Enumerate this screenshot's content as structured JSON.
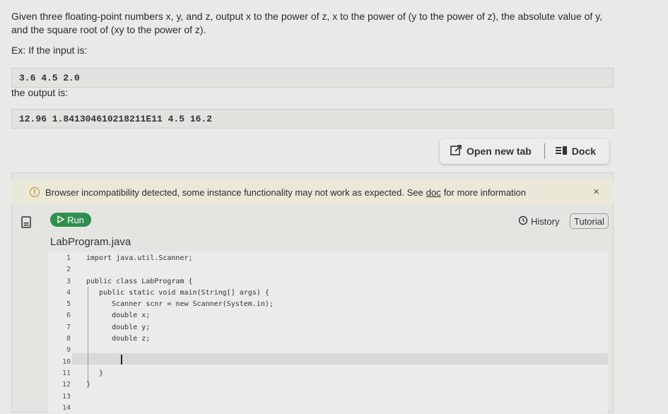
{
  "problem": {
    "statement": "Given three floating-point numbers x, y, and z, output x to the power of z, x to the power of (y to the power of z), the absolute value of y, and the square root of (xy to the power of z).",
    "example_intro": "Ex: If the input is:",
    "input_value": "3.6 4.5 2.0",
    "output_intro": "the output is:",
    "output_value": "12.96 1.841304610218211E11 4.5 16.2"
  },
  "toolbar": {
    "open_new_tab": "Open new tab",
    "dock": "Dock"
  },
  "warning": {
    "text_before": "Browser incompatibility detected, some instance functionality may not work as expected. See",
    "link": "doc",
    "text_after": "for more information",
    "close": "×"
  },
  "ide": {
    "run_label": "Run",
    "history_label": "History",
    "tutorial_label": "Tutorial",
    "filename": "LabProgram.java",
    "line_numbers": [
      "1",
      "2",
      "3",
      "4",
      "5",
      "6",
      "7",
      "8",
      "9",
      "10",
      "11",
      "12",
      "13",
      "14"
    ],
    "code_lines": [
      "import java.util.Scanner;",
      "",
      "public class LabProgram {",
      "   public static void main(String[] args) {",
      "      Scanner scnr = new Scanner(System.in);",
      "      double x;",
      "      double y;",
      "      double z;",
      "",
      "",
      "   }",
      "}",
      "",
      ""
    ]
  },
  "colors": {
    "run_green": "#2f8f4e",
    "warning_bg": "#ece8d8",
    "warning_icon": "#b89020"
  }
}
